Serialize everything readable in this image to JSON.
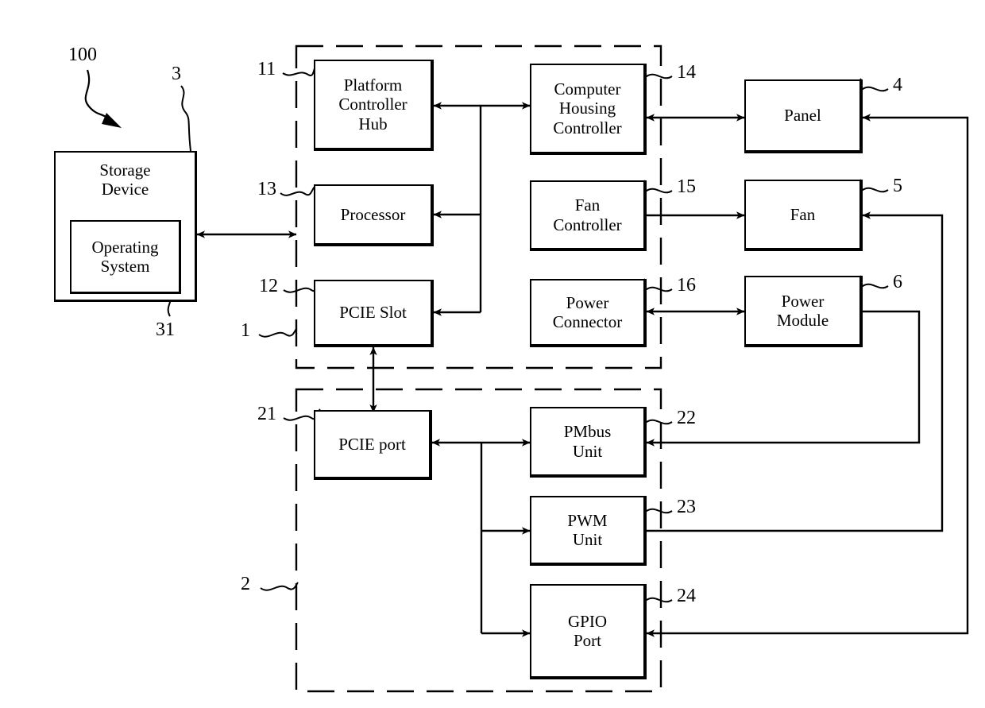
{
  "figure": {
    "system_label": "100",
    "type": "block-diagram"
  },
  "blocks": {
    "storage_device": {
      "label": "Storage\nDevice",
      "ref": "3"
    },
    "operating_system": {
      "label": "Operating\nSystem",
      "ref": "31"
    },
    "platform_controller_hub": {
      "label": "Platform\nController\nHub",
      "ref": "11"
    },
    "processor": {
      "label": "Processor",
      "ref": "13"
    },
    "pcie_slot": {
      "label": "PCIE Slot",
      "ref": "12"
    },
    "computer_housing_controller": {
      "label": "Computer\nHousing\nController",
      "ref": "14"
    },
    "fan_controller": {
      "label": "Fan\nController",
      "ref": "15"
    },
    "power_connector": {
      "label": "Power\nConnector",
      "ref": "16"
    },
    "panel": {
      "label": "Panel",
      "ref": "4"
    },
    "fan": {
      "label": "Fan",
      "ref": "5"
    },
    "power_module": {
      "label": "Power\nModule",
      "ref": "6"
    },
    "pcie_port": {
      "label": "PCIE port",
      "ref": "21"
    },
    "pmbus_unit": {
      "label": "PMbus\nUnit",
      "ref": "22"
    },
    "pwm_unit": {
      "label": "PWM\nUnit",
      "ref": "23"
    },
    "gpio_port": {
      "label": "GPIO\nPort",
      "ref": "24"
    }
  },
  "groups": {
    "motherboard": {
      "ref": "1"
    },
    "expansion_card": {
      "ref": "2"
    }
  },
  "colors": {
    "stroke": "#000000",
    "background": "#ffffff"
  }
}
